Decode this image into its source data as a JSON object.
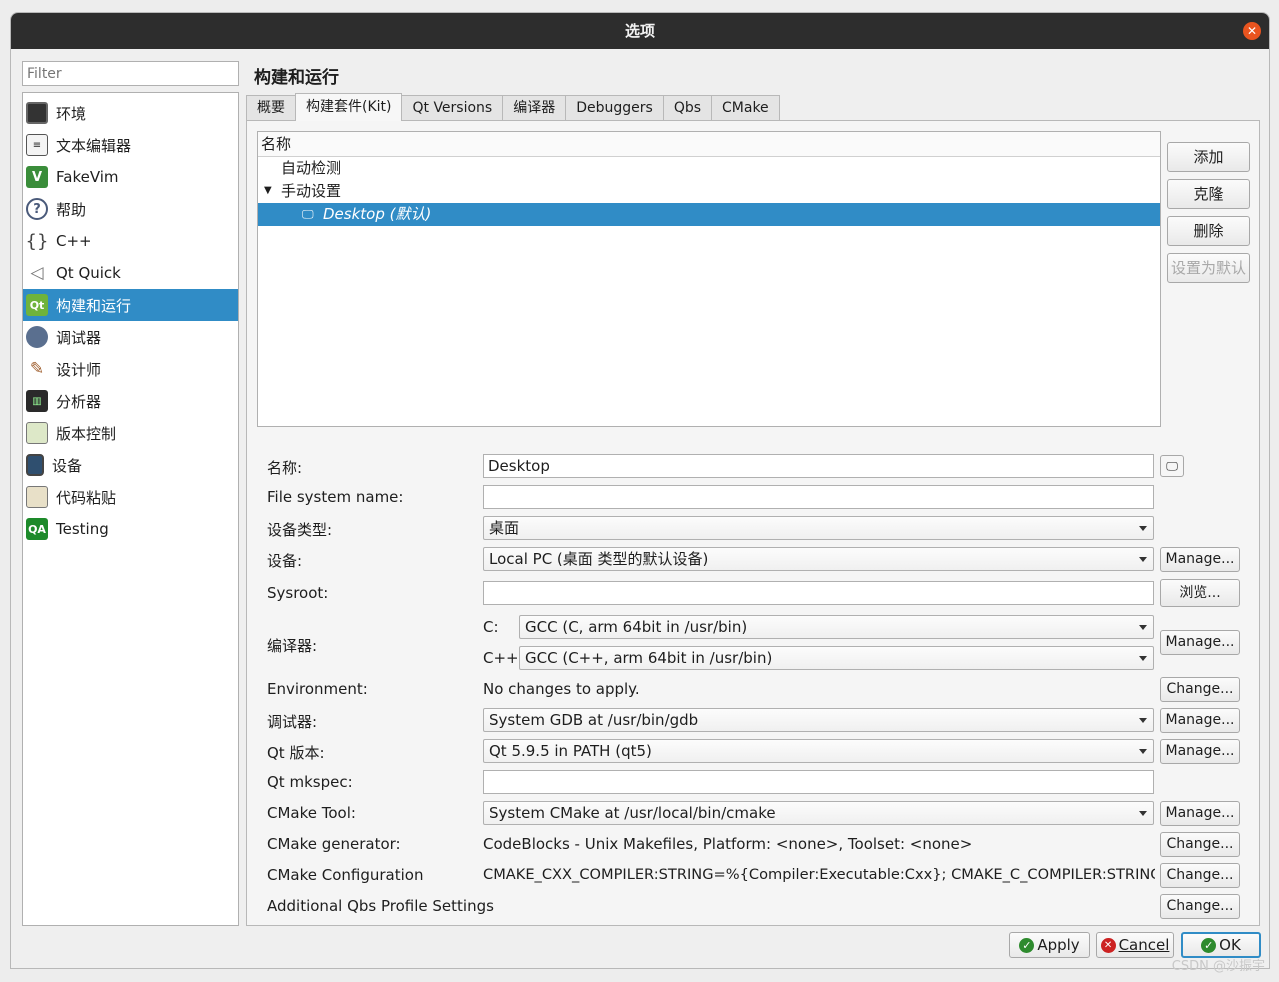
{
  "window": {
    "title": "选项"
  },
  "filter": {
    "placeholder": "Filter"
  },
  "sidebar": {
    "items": [
      {
        "label": "环境"
      },
      {
        "label": "文本编辑器"
      },
      {
        "label": "FakeVim"
      },
      {
        "label": "帮助"
      },
      {
        "label": "C++"
      },
      {
        "label": "Qt Quick"
      },
      {
        "label": "构建和运行"
      },
      {
        "label": "调试器"
      },
      {
        "label": "设计师"
      },
      {
        "label": "分析器"
      },
      {
        "label": "版本控制"
      },
      {
        "label": "设备"
      },
      {
        "label": "代码粘贴"
      },
      {
        "label": "Testing"
      }
    ],
    "selected": "构建和运行"
  },
  "page": {
    "title": "构建和运行"
  },
  "tabs": [
    {
      "label": "概要"
    },
    {
      "label": "构建套件(Kit)"
    },
    {
      "label": "Qt Versions"
    },
    {
      "label": "编译器"
    },
    {
      "label": "Debuggers"
    },
    {
      "label": "Qbs"
    },
    {
      "label": "CMake"
    }
  ],
  "kit_tree": {
    "header": "名称",
    "rows": [
      {
        "label": "自动检测"
      },
      {
        "label": "手动设置"
      },
      {
        "label": "Desktop (默认)"
      }
    ]
  },
  "kit_buttons": {
    "add": "添加",
    "clone": "克隆",
    "remove": "删除",
    "set_default": "设置为默认"
  },
  "form": {
    "name_label": "名称:",
    "name_value": "Desktop",
    "fs_label": "File system name:",
    "fs_value": "",
    "device_type_label": "设备类型:",
    "device_type_value": "桌面",
    "device_label": "设备:",
    "device_value": "Local PC (桌面 类型的默认设备)",
    "sysroot_label": "Sysroot:",
    "sysroot_value": "",
    "compiler_label": "编译器:",
    "c_label": "C:",
    "c_value": "GCC (C, arm 64bit in /usr/bin)",
    "cxx_label": "C++:",
    "cxx_value": "GCC (C++, arm 64bit in /usr/bin)",
    "env_label": "Environment:",
    "env_value": "No changes to apply.",
    "debugger_label": "调试器:",
    "debugger_value": "System GDB at /usr/bin/gdb",
    "qt_label": "Qt 版本:",
    "qt_value": "Qt 5.9.5 in PATH (qt5)",
    "mkspec_label": "Qt mkspec:",
    "mkspec_value": "",
    "cmake_tool_label": "CMake Tool:",
    "cmake_tool_value": "System CMake at /usr/local/bin/cmake",
    "cmake_gen_label": "CMake generator:",
    "cmake_gen_value": "CodeBlocks - Unix Makefiles, Platform: <none>, Toolset: <none>",
    "cmake_conf_label": "CMake Configuration",
    "cmake_conf_value": "CMAKE_CXX_COMPILER:STRING=%{Compiler:Executable:Cxx}; CMAKE_C_COMPILER:STRING=%{…",
    "qbs_label": "Additional Qbs Profile Settings",
    "manage": "Manage...",
    "browse": "浏览...",
    "change": "Change..."
  },
  "footer": {
    "apply": "Apply",
    "cancel": "Cancel",
    "ok": "OK"
  },
  "watermark": "CSDN @沙振宇"
}
